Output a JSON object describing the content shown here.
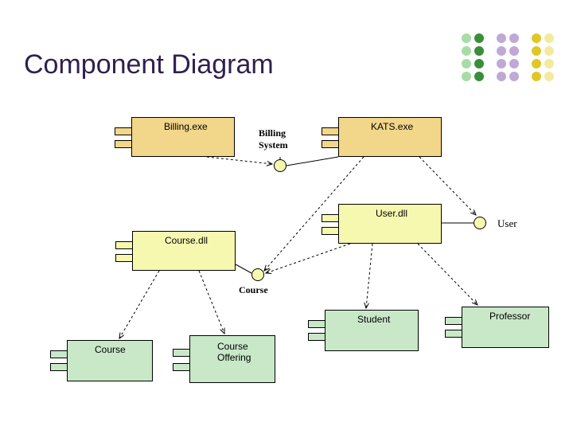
{
  "title": "Component Diagram",
  "components": {
    "billing": {
      "label": "Billing.exe"
    },
    "kats": {
      "label": "KATS.exe"
    },
    "userdll": {
      "label": "User.dll"
    },
    "coursedll": {
      "label": "Course.dll"
    },
    "student": {
      "label": "Student"
    },
    "professor": {
      "label": "Professor"
    },
    "course": {
      "label": "Course"
    },
    "courseoffering": {
      "label": "Course\nOffering"
    }
  },
  "interfaces": {
    "billingSystem": {
      "label": "Billing\nSystem"
    },
    "course": {
      "label": "Course"
    },
    "user": {
      "label": "User"
    }
  },
  "colors": {
    "tan": "#f2d68a",
    "lemon": "#f7f8b0",
    "mint": "#c8e8c8",
    "title": "#2e2150"
  }
}
